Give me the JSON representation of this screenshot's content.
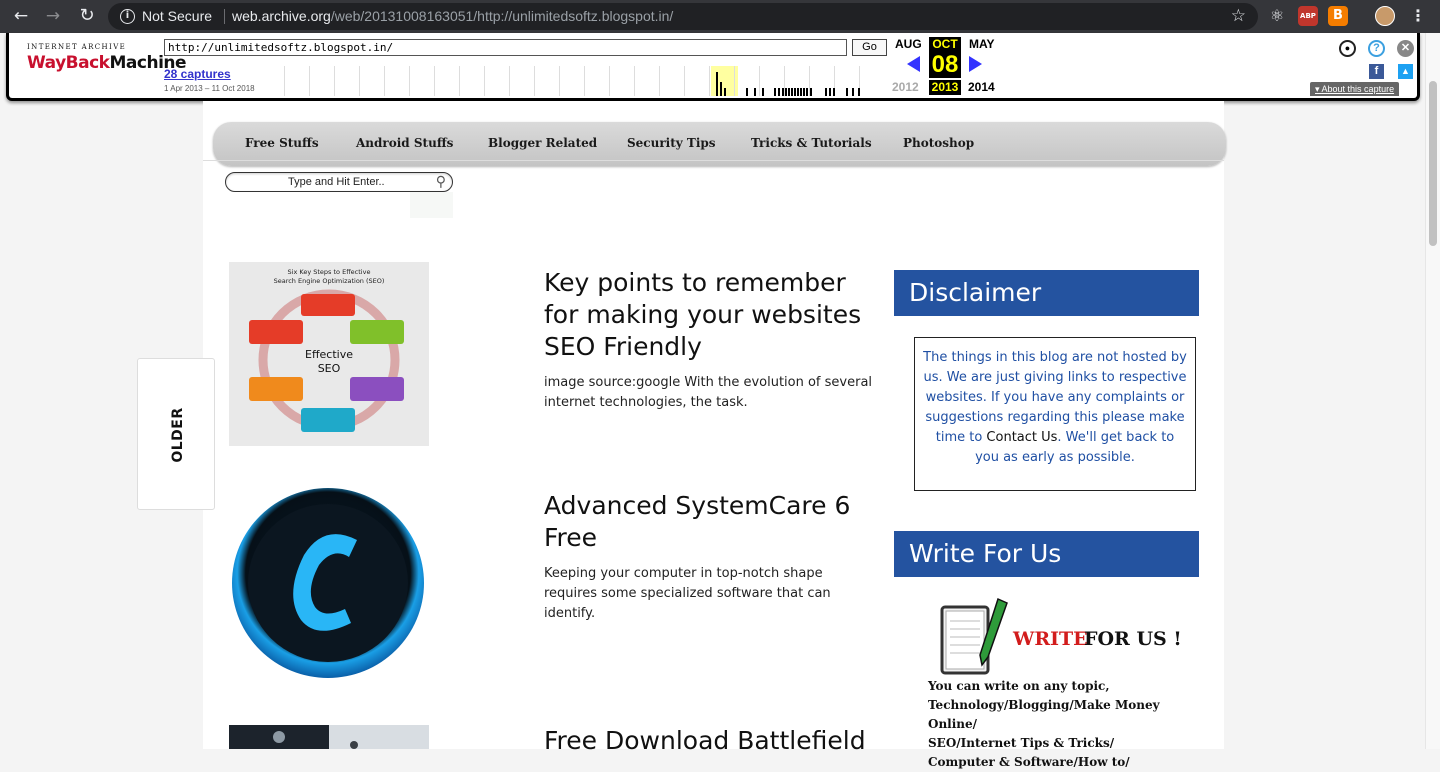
{
  "browser": {
    "security_label": "Not Secure",
    "url_host": "web.archive.org",
    "url_path": "/web/20131008163051/http://unlimitedsoftz.blogspot.in/"
  },
  "wayback": {
    "logo_top": "INTERNET ARCHIVE",
    "logo_way": "WayBack",
    "logo_machine": "Machine",
    "url_value": "http://unlimitedsoftz.blogspot.in/",
    "go_label": "Go",
    "captures": "28 captures",
    "date_range": "1 Apr 2013 – 11 Oct 2018",
    "prev_month": "AUG",
    "cur_month": "OCT",
    "next_month": "MAY",
    "cur_day": "08",
    "prev_year": "2012",
    "cur_year": "2013",
    "next_year": "2014",
    "about": "About this capture"
  },
  "nav": {
    "items": [
      "Free Stuffs",
      "Android Stuffs",
      "Blogger Related",
      "Security Tips",
      "Tricks & Tutorials",
      "Photoshop"
    ]
  },
  "search": {
    "placeholder": "Type and Hit Enter.."
  },
  "older_label": "OLDER",
  "posts": [
    {
      "title": "Key points to remember for making your websites SEO Friendly",
      "excerpt": "image source:google With the evolution of several internet technologies, the task.",
      "image": {
        "heading_line1": "Six Key Steps to Effective",
        "heading_line2": "Search Engine Optimization (SEO)",
        "center_line1": "Effective",
        "center_line2": "SEO"
      }
    },
    {
      "title": "Advanced SystemCare 6 Free",
      "excerpt": "Keeping your computer in top-notch shape requires some specialized software that can identify."
    },
    {
      "title": "Free Download Battlefield",
      "excerpt": ""
    }
  ],
  "sidebar": {
    "disclaimer_title": "Disclaimer",
    "disclaimer_text_1": "The things in this blog are not hosted by us. We are just giving links to respective websites. If you have any complaints or suggestions regarding this please make time to ",
    "disclaimer_link": "Contact Us",
    "disclaimer_text_2": ". We'll get back to you as early as possible.",
    "write_title": "Write For Us",
    "write_banner_red": "WRITE",
    "write_banner_black": " FOR US !",
    "write_lines": [
      "You can write on any topic,",
      "Technology/Blogging/Make Money Online/",
      "SEO/Internet Tips & Tricks/",
      "Computer & Software/How to/"
    ]
  }
}
